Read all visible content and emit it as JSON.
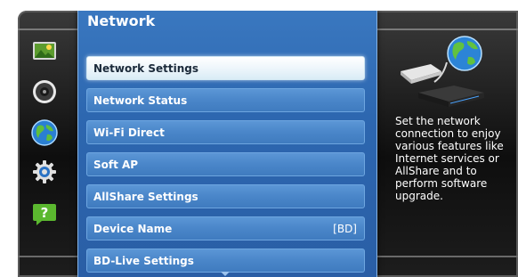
{
  "menu": {
    "title": "Network",
    "items": [
      {
        "label": "Network Settings",
        "value": "",
        "selected": true
      },
      {
        "label": "Network Status",
        "value": ""
      },
      {
        "label": "Wi-Fi Direct",
        "value": ""
      },
      {
        "label": "Soft AP",
        "value": ""
      },
      {
        "label": "AllShare Settings",
        "value": ""
      },
      {
        "label": "Device Name",
        "value": "[BD]"
      },
      {
        "label": "BD-Live Settings",
        "value": ""
      }
    ]
  },
  "sidebar": {
    "icons": [
      "picture-icon",
      "sound-icon",
      "network-globe-icon",
      "settings-gear-icon",
      "support-question-icon"
    ],
    "active": "network-globe-icon"
  },
  "help": {
    "text": "Set the network connection to enjoy various features like Internet services or AllShare and to perform software upgrade."
  },
  "colors": {
    "panel": "#2d67b0",
    "item": "#4a86c9",
    "selected": "#eef6fb",
    "background": "#0e0e0e"
  }
}
